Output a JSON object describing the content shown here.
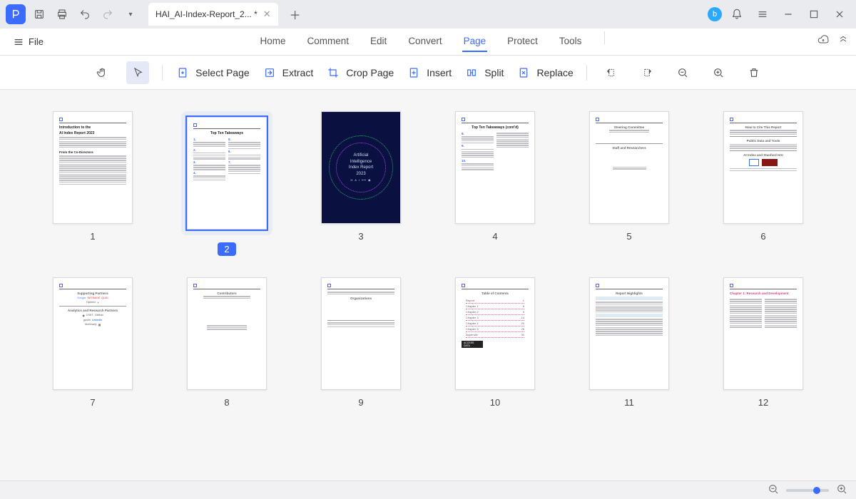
{
  "titlebar": {
    "tab_label": "HAI_AI-Index-Report_2... *",
    "user_badge": "b"
  },
  "menubar": {
    "file": "File",
    "items": [
      "Home",
      "Comment",
      "Edit",
      "Convert",
      "Page",
      "Protect",
      "Tools"
    ],
    "active_index": 4
  },
  "toolbar": {
    "select_page": "Select Page",
    "extract": "Extract",
    "crop_page": "Crop Page",
    "insert": "Insert",
    "split": "Split",
    "replace": "Replace"
  },
  "pages": {
    "selected": 2,
    "count": 12,
    "labels": [
      "1",
      "2",
      "3",
      "4",
      "5",
      "6",
      "7",
      "8",
      "9",
      "10",
      "11",
      "12"
    ],
    "content": {
      "p1": {
        "title": "Introduction to the",
        "title2": "AI Index Report 2023",
        "sect": "From the Co-Directors"
      },
      "p2": {
        "title": "Top Ten Takeaways"
      },
      "p3": {
        "l1": "Artificial",
        "l2": "Intelligence",
        "l3": "Index Report",
        "l4": "2023"
      },
      "p4": {
        "title": "Top Ten Takeaways (cont'd)"
      },
      "p5": {
        "s1": "Steering Committee",
        "s2": "Staff and Researchers"
      },
      "p6": {
        "s1": "How to Cite This Report",
        "s2": "Public Data and Tools",
        "s3": "AI Index and Stanford HAI"
      },
      "p7": {
        "s1": "Supporting Partners",
        "s2": "Analytics and Research Partners",
        "logos1": [
          "Google",
          "NETBASE",
          "QUID",
          "OpenAI"
        ],
        "logos2": [
          "CSET",
          "GitHub",
          "LinkedIn",
          "govini",
          "McKinsey"
        ]
      },
      "p8": {
        "title": "Contributors"
      },
      "p9": {
        "title": "Organizations"
      },
      "p10": {
        "title": "Table of Contents"
      },
      "p11": {
        "title": "Report Highlights"
      },
      "p12": {
        "title": "Chapter 1: Research and Development"
      }
    }
  }
}
